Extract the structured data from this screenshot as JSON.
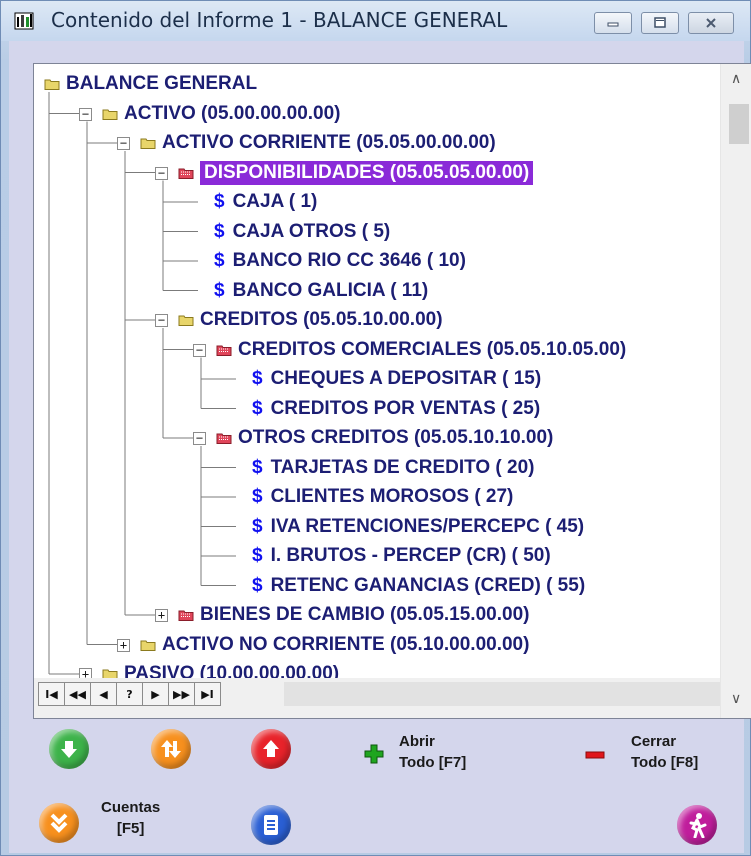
{
  "window": {
    "title": "Contenido del Informe 1 - BALANCE GENERAL"
  },
  "tree": {
    "nodes": [
      {
        "label": "BALANCE GENERAL",
        "kind": "folder",
        "expander": "",
        "selected": false
      },
      {
        "label": "ACTIVO  (05.00.00.00.00)",
        "kind": "folder",
        "expander": "−",
        "selected": false
      },
      {
        "label": "ACTIVO CORRIENTE  (05.05.00.00.00)",
        "kind": "folder",
        "expander": "−",
        "selected": false
      },
      {
        "label": "DISPONIBILIDADES  (05.05.05.00.00)",
        "kind": "folder-red",
        "expander": "−",
        "selected": true
      },
      {
        "label": "CAJA (   1)",
        "kind": "account"
      },
      {
        "label": "CAJA OTROS (   5)",
        "kind": "account"
      },
      {
        "label": "BANCO RIO CC 3646 (  10)",
        "kind": "account"
      },
      {
        "label": "BANCO GALICIA (  11)",
        "kind": "account"
      },
      {
        "label": "CREDITOS  (05.05.10.00.00)",
        "kind": "folder",
        "expander": "−"
      },
      {
        "label": "CREDITOS COMERCIALES  (05.05.10.05.00)",
        "kind": "folder-red",
        "expander": "−"
      },
      {
        "label": "CHEQUES A DEPOSITAR (  15)",
        "kind": "account"
      },
      {
        "label": "CREDITOS POR VENTAS (  25)",
        "kind": "account"
      },
      {
        "label": "OTROS CREDITOS  (05.05.10.10.00)",
        "kind": "folder-red",
        "expander": "−"
      },
      {
        "label": "TARJETAS DE CREDITO (  20)",
        "kind": "account"
      },
      {
        "label": "CLIENTES MOROSOS (  27)",
        "kind": "account"
      },
      {
        "label": "IVA RETENCIONES/PERCEPC (  45)",
        "kind": "account"
      },
      {
        "label": "I. BRUTOS - PERCEP (CR) (  50)",
        "kind": "account"
      },
      {
        "label": "RETENC GANANCIAS (CRED) (  55)",
        "kind": "account"
      },
      {
        "label": "BIENES DE CAMBIO  (05.05.15.00.00)",
        "kind": "folder-red",
        "expander": "+"
      },
      {
        "label": "ACTIVO NO CORRIENTE  (05.10.00.00.00)",
        "kind": "folder",
        "expander": "+"
      },
      {
        "label": "PASIVO  (10.00.00.00.00)",
        "kind": "folder",
        "expander": "+"
      }
    ]
  },
  "navigator": {
    "buttons": [
      "I◀",
      "◀◀",
      "◀",
      "?",
      "▶",
      "▶▶",
      "▶I"
    ]
  },
  "actions": {
    "open_all": [
      "Abrir",
      "Todo [F7]"
    ],
    "close_all": [
      "Cerrar",
      "Todo [F8]"
    ],
    "accounts": [
      "Cuentas",
      "[F5]"
    ]
  },
  "colors": {
    "selection": "#8a2ad8",
    "tree_text": "#1c1e73",
    "dollar": "#1010f0",
    "green_btn": "#3db34a",
    "orange_btn": "#f7901e",
    "red_btn": "#e8232a",
    "blue_btn": "#2a5fd4",
    "magenta_btn": "#c01d9c"
  }
}
